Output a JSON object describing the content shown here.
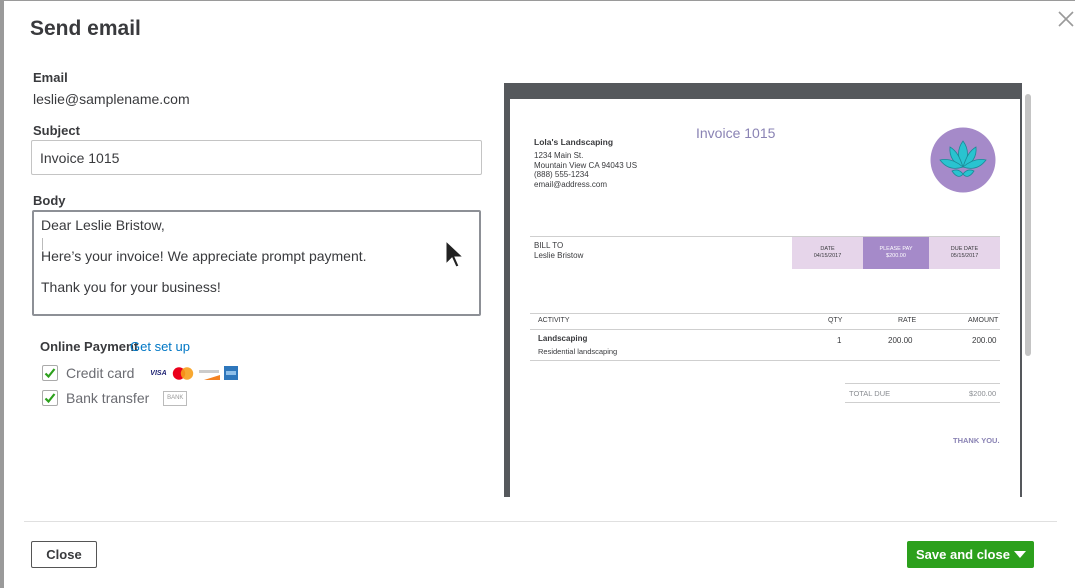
{
  "dialog": {
    "title": "Send email",
    "email_label": "Email",
    "email_value": "leslie@samplename.com",
    "subject_label": "Subject",
    "subject_value": "Invoice 1015",
    "body_label": "Body",
    "body_lines": [
      "Dear Leslie Bristow,",
      "Here’s your invoice! We appreciate prompt payment.",
      "Thank you for your business!"
    ],
    "online_payment_label": "Online Payment",
    "get_set_up_link": "Get set up",
    "payment_options": [
      {
        "label": "Credit card",
        "checked": true,
        "icons": [
          "visa-icon",
          "mastercard-icon",
          "discover-icon",
          "amex-icon"
        ]
      },
      {
        "label": "Bank transfer",
        "checked": true,
        "icons": [
          "bank-icon"
        ]
      }
    ],
    "card_icon_text": {
      "visa": "VISA",
      "discover": "DISCOVER",
      "bank": "BANK"
    },
    "close_button": "Close",
    "save_button": "Save and close",
    "colors": {
      "primary_green": "#2ca01c",
      "link_blue": "#0077c5",
      "invoice_purple": "#a58ac9",
      "invoice_light_purple": "#e6d5ea",
      "logo_teal": "#29c3d0"
    }
  },
  "invoice": {
    "company_name": "Lola's Landscaping",
    "address_lines": [
      "1234 Main St.",
      "Mountain View CA 94043 US",
      "(888) 555-1234",
      "email@address.com"
    ],
    "title": "Invoice 1015",
    "bill_to_label": "BILL TO",
    "bill_to_name": "Leslie Bristow",
    "date_label": "DATE",
    "date_value": "04/15/2017",
    "please_pay_label": "PLEASE PAY",
    "please_pay_value": "$200.00",
    "due_date_label": "DUE DATE",
    "due_date_value": "05/15/2017",
    "columns": [
      "ACTIVITY",
      "QTY",
      "RATE",
      "AMOUNT"
    ],
    "lines": [
      {
        "activity": "Landscaping",
        "description": "Residential landscaping",
        "qty": "1",
        "rate": "200.00",
        "amount": "200.00"
      }
    ],
    "total_due_label": "TOTAL DUE",
    "total_due_value": "$200.00",
    "thank_you": "THANK YOU."
  }
}
